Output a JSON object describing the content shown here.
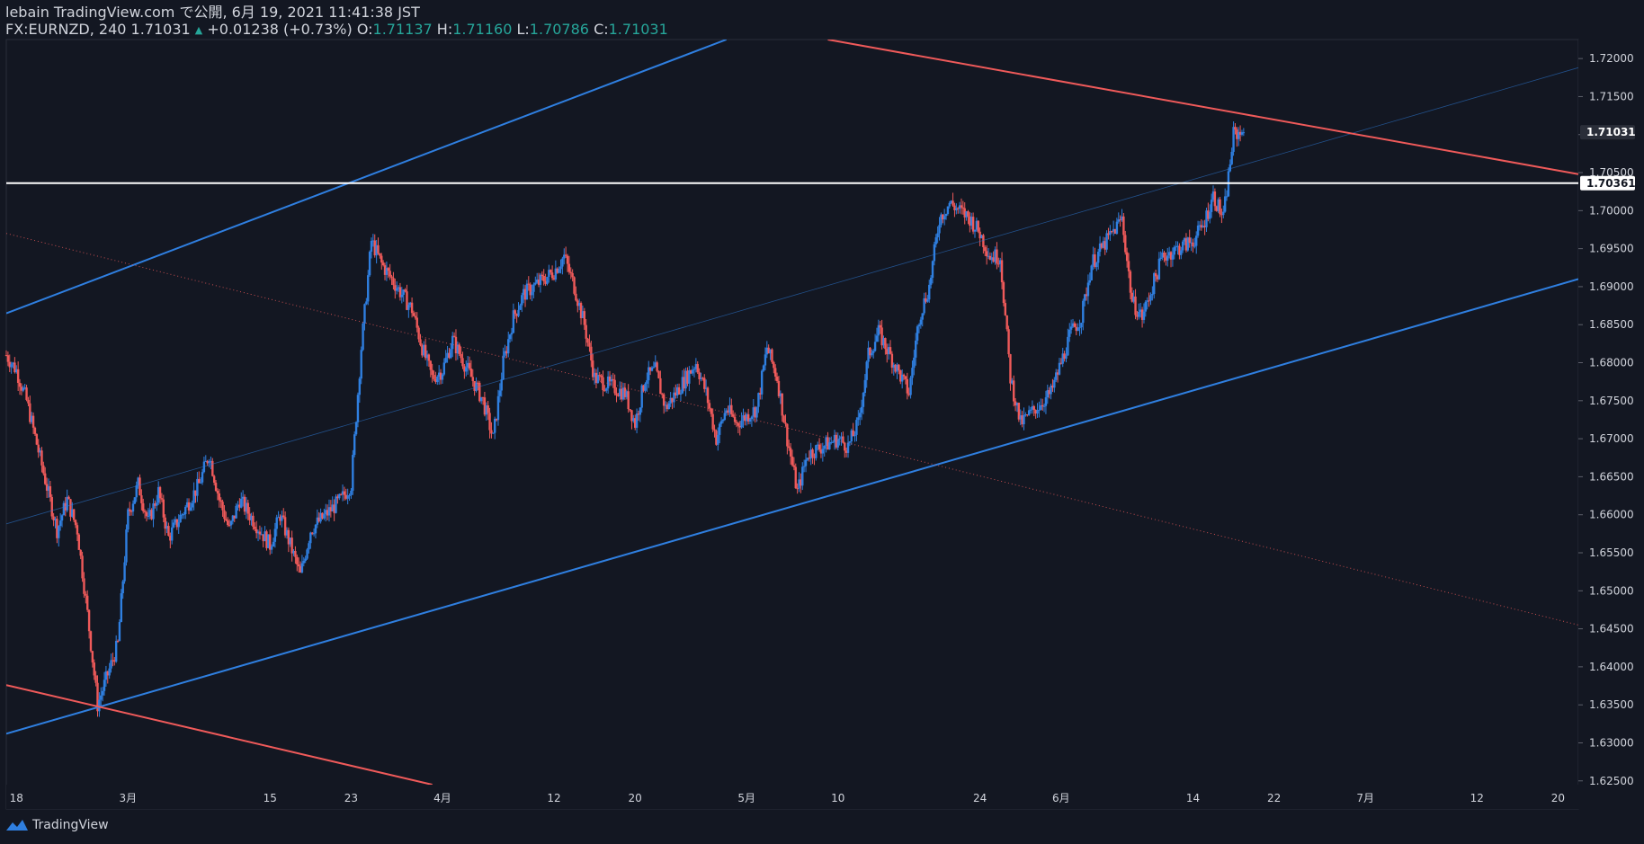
{
  "header": {
    "publisher": "lebain TradingView.com で公開, 6月 19, 2021 11:41:38 JST",
    "symbol": "FX:EURNZD, 240 1.71031",
    "change": "+0.01238 (+0.73%)",
    "o_label": "O:",
    "o_value": "1.71137",
    "h_label": "H:",
    "h_value": "1.71160",
    "l_label": "L:",
    "l_value": "1.70786",
    "c_label": "C:",
    "c_value": "1.71031"
  },
  "footer": {
    "brand": "TradingView",
    "logo_icon": "tradingview-logo-icon"
  },
  "colors": {
    "background": "#131722",
    "up": "#2f7fe0",
    "down": "#ef5a5a",
    "channel": "#2f7fe0",
    "trend": "#ef5a5a",
    "level": "#ffffff",
    "text": "#d1d4dc",
    "accent": "#26a69a"
  },
  "chart_data": {
    "type": "candlestick",
    "symbol": "FX:EURNZD",
    "timeframe": "240",
    "ylim": [
      1.6245,
      1.7225
    ],
    "xlim": [
      "2021-02-17",
      "2021-07-22"
    ],
    "y_ticks": [
      1.625,
      1.63,
      1.635,
      1.64,
      1.645,
      1.65,
      1.655,
      1.66,
      1.665,
      1.67,
      1.675,
      1.68,
      1.685,
      1.69,
      1.695,
      1.7,
      1.705,
      1.71,
      1.715,
      1.72
    ],
    "y_tick_labels": [
      "1.62500",
      "1.63000",
      "1.63500",
      "1.64000",
      "1.64500",
      "1.65000",
      "1.65500",
      "1.66000",
      "1.66500",
      "1.67000",
      "1.67500",
      "1.68000",
      "1.68500",
      "1.69000",
      "1.69500",
      "1.70000",
      "1.70500",
      "1.71000",
      "1.71500",
      "1.72000"
    ],
    "x_ticks": [
      {
        "label": "18",
        "date": "2021-02-18"
      },
      {
        "label": "3月",
        "date": "2021-03-01"
      },
      {
        "label": "15",
        "date": "2021-03-15"
      },
      {
        "label": "23",
        "date": "2021-03-23"
      },
      {
        "label": "4月",
        "date": "2021-04-01"
      },
      {
        "label": "12",
        "date": "2021-04-12"
      },
      {
        "label": "20",
        "date": "2021-04-20"
      },
      {
        "label": "5月",
        "date": "2021-05-01"
      },
      {
        "label": "10",
        "date": "2021-05-10"
      },
      {
        "label": "24",
        "date": "2021-05-24"
      },
      {
        "label": "6月",
        "date": "2021-06-01"
      },
      {
        "label": "14",
        "date": "2021-06-14"
      },
      {
        "label": "22",
        "date": "2021-06-22"
      },
      {
        "label": "7月",
        "date": "2021-07-01"
      },
      {
        "label": "12",
        "date": "2021-07-12"
      },
      {
        "label": "20",
        "date": "2021-07-20"
      }
    ],
    "price_path": [
      [
        "2021-02-17",
        1.681
      ],
      [
        "2021-02-18",
        1.679
      ],
      [
        "2021-02-19",
        1.675
      ],
      [
        "2021-02-22",
        1.658
      ],
      [
        "2021-02-23",
        1.662
      ],
      [
        "2021-02-24",
        1.658
      ],
      [
        "2021-02-25",
        1.647
      ],
      [
        "2021-02-26",
        1.635
      ],
      [
        "2021-02-28",
        1.643
      ],
      [
        "2021-03-01",
        1.66
      ],
      [
        "2021-03-02",
        1.664
      ],
      [
        "2021-03-03",
        1.659
      ],
      [
        "2021-03-04",
        1.663
      ],
      [
        "2021-03-05",
        1.657
      ],
      [
        "2021-03-08",
        1.664
      ],
      [
        "2021-03-09",
        1.668
      ],
      [
        "2021-03-10",
        1.662
      ],
      [
        "2021-03-11",
        1.658
      ],
      [
        "2021-03-12",
        1.662
      ],
      [
        "2021-03-15",
        1.656
      ],
      [
        "2021-03-16",
        1.66
      ],
      [
        "2021-03-17",
        1.656
      ],
      [
        "2021-03-18",
        1.652
      ],
      [
        "2021-03-19",
        1.658
      ],
      [
        "2021-03-22",
        1.662
      ],
      [
        "2021-03-23",
        1.664
      ],
      [
        "2021-03-24",
        1.682
      ],
      [
        "2021-03-25",
        1.696
      ],
      [
        "2021-03-26",
        1.693
      ],
      [
        "2021-03-29",
        1.687
      ],
      [
        "2021-03-30",
        1.682
      ],
      [
        "2021-03-31",
        1.678
      ],
      [
        "2021-04-01",
        1.679
      ],
      [
        "2021-04-02",
        1.683
      ],
      [
        "2021-04-05",
        1.675
      ],
      [
        "2021-04-06",
        1.67
      ],
      [
        "2021-04-07",
        1.68
      ],
      [
        "2021-04-08",
        1.686
      ],
      [
        "2021-04-09",
        1.689
      ],
      [
        "2021-04-12",
        1.692
      ],
      [
        "2021-04-13",
        1.694
      ],
      [
        "2021-04-14",
        1.69
      ],
      [
        "2021-04-15",
        1.685
      ],
      [
        "2021-04-16",
        1.678
      ],
      [
        "2021-04-19",
        1.676
      ],
      [
        "2021-04-20",
        1.672
      ],
      [
        "2021-04-21",
        1.678
      ],
      [
        "2021-04-22",
        1.679
      ],
      [
        "2021-04-23",
        1.674
      ],
      [
        "2021-04-26",
        1.68
      ],
      [
        "2021-04-27",
        1.676
      ],
      [
        "2021-04-28",
        1.67
      ],
      [
        "2021-04-29",
        1.674
      ],
      [
        "2021-04-30",
        1.672
      ],
      [
        "2021-05-02",
        1.674
      ],
      [
        "2021-05-03",
        1.682
      ],
      [
        "2021-05-04",
        1.678
      ],
      [
        "2021-05-05",
        1.67
      ],
      [
        "2021-05-06",
        1.663
      ],
      [
        "2021-05-07",
        1.668
      ],
      [
        "2021-05-10",
        1.67
      ],
      [
        "2021-05-11",
        1.669
      ],
      [
        "2021-05-12",
        1.672
      ],
      [
        "2021-05-13",
        1.681
      ],
      [
        "2021-05-14",
        1.684
      ],
      [
        "2021-05-17",
        1.676
      ],
      [
        "2021-05-18",
        1.686
      ],
      [
        "2021-05-19",
        1.69
      ],
      [
        "2021-05-20",
        1.699
      ],
      [
        "2021-05-21",
        1.701
      ],
      [
        "2021-05-23",
        1.699
      ],
      [
        "2021-05-24",
        1.697
      ],
      [
        "2021-05-25",
        1.694
      ],
      [
        "2021-05-26",
        1.694
      ],
      [
        "2021-05-27",
        1.678
      ],
      [
        "2021-05-28",
        1.672
      ],
      [
        "2021-05-31",
        1.676
      ],
      [
        "2021-06-01",
        1.68
      ],
      [
        "2021-06-02",
        1.684
      ],
      [
        "2021-06-03",
        1.686
      ],
      [
        "2021-06-04",
        1.693
      ],
      [
        "2021-06-07",
        1.699
      ],
      [
        "2021-06-08",
        1.688
      ],
      [
        "2021-06-09",
        1.686
      ],
      [
        "2021-06-10",
        1.69
      ],
      [
        "2021-06-11",
        1.694
      ],
      [
        "2021-06-14",
        1.696
      ],
      [
        "2021-06-15",
        1.698
      ],
      [
        "2021-06-16",
        1.702
      ],
      [
        "2021-06-17",
        1.699
      ],
      [
        "2021-06-18",
        1.71
      ],
      [
        "2021-06-19",
        1.7103
      ]
    ],
    "last_price": 1.71031,
    "horizontal_level": 1.70361,
    "channel_lines": [
      {
        "from": [
          "2021-02-17",
          1.6865
        ],
        "to": [
          "2021-04-29",
          1.7225
        ]
      },
      {
        "from": [
          "2021-02-17",
          1.6312
        ],
        "to": [
          "2021-07-22",
          1.691
        ]
      },
      {
        "from": [
          "2021-02-17",
          1.6588
        ],
        "to": [
          "2021-07-22",
          1.7188
        ],
        "style": "thin"
      }
    ],
    "trend_lines": [
      {
        "from": [
          "2021-05-09",
          1.7225
        ],
        "to": [
          "2021-07-22",
          1.7048
        ]
      },
      {
        "from": [
          "2021-02-17",
          1.6376
        ],
        "to": [
          "2021-03-31",
          1.6245
        ]
      },
      {
        "from": [
          "2021-02-17",
          1.697
        ],
        "to": [
          "2021-07-22",
          1.6455
        ],
        "style": "dotted"
      }
    ]
  }
}
